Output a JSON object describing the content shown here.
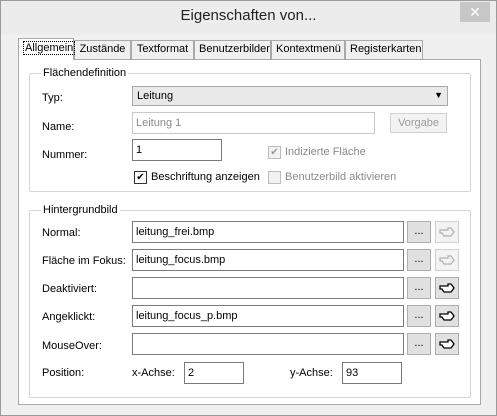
{
  "window": {
    "title": "Eigenschaften von...",
    "close_glyph": "✕"
  },
  "tabs": [
    {
      "label": "Allgemein",
      "active": true
    },
    {
      "label": "Zustände"
    },
    {
      "label": "Textformat"
    },
    {
      "label": "Benutzerbilder"
    },
    {
      "label": "Kontextmenü"
    },
    {
      "label": "Registerkarten"
    }
  ],
  "area": {
    "legend": "Flächendefinition",
    "type_label": "Typ:",
    "type_value": "Leitung",
    "name_label": "Name:",
    "name_value": "Leitung 1",
    "default_button": "Vorgabe",
    "number_label": "Nummer:",
    "number_value": "1",
    "indexed_label": "Indizierte Fläche",
    "indexed_checked": true,
    "caption_label": "Beschriftung anzeigen",
    "caption_checked": true,
    "userimage_label": "Benutzerbild aktivieren",
    "userimage_checked": false
  },
  "background": {
    "legend": "Hintergrundbild",
    "rows": [
      {
        "label": "Normal:",
        "value": "leitung_frei.bmp",
        "browse": "...",
        "icon_enabled": false
      },
      {
        "label": "Fläche im Fokus:",
        "value": "leitung_focus.bmp",
        "browse": "...",
        "icon_enabled": false
      },
      {
        "label": "Deaktiviert:",
        "value": "",
        "browse": "...",
        "icon_enabled": true
      },
      {
        "label": "Angeklickt:",
        "value": "leitung_focus_p.bmp",
        "browse": "...",
        "icon_enabled": true
      },
      {
        "label": "MouseOver:",
        "value": "",
        "browse": "...",
        "icon_enabled": true
      }
    ],
    "position_label": "Position:",
    "x_label": "x-Achse:",
    "x_value": "2",
    "y_label": "y-Achse:",
    "y_value": "93"
  },
  "icons": {
    "close": "close-icon",
    "dropdown": "chevron-down-icon",
    "pick": "hand-pointer-icon"
  }
}
